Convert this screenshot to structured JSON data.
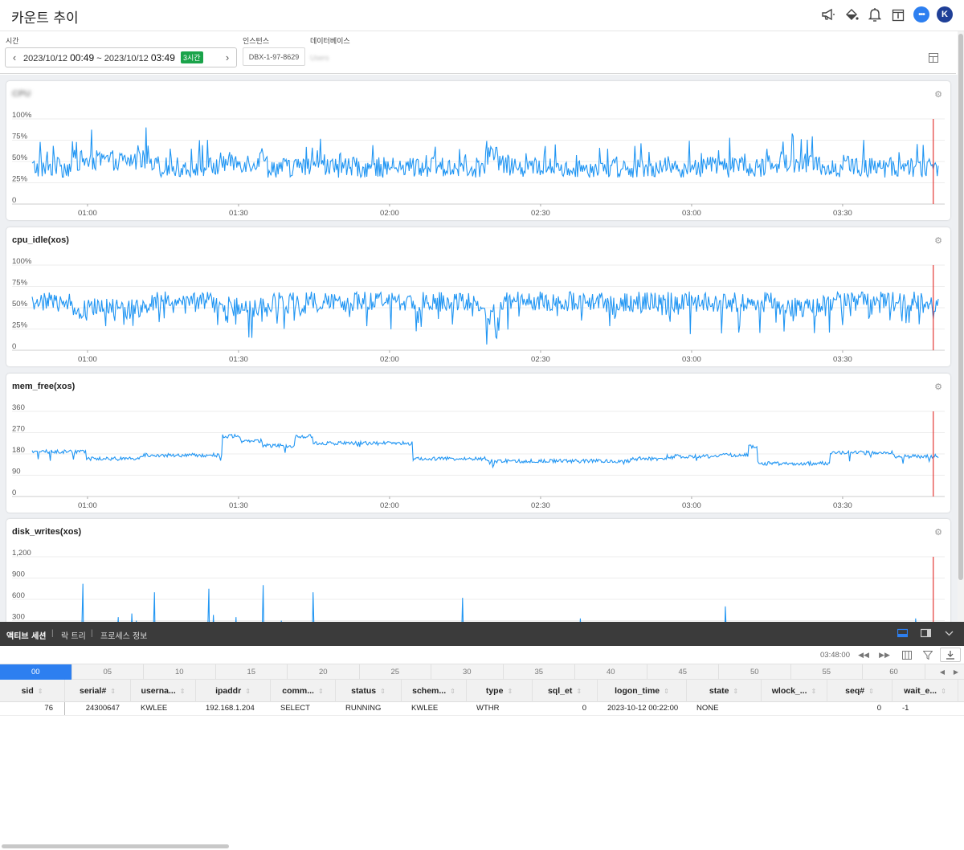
{
  "page": {
    "title": "카운트 추이"
  },
  "header_icons": [
    "megaphone-icon",
    "paint-bucket-icon",
    "bell-icon",
    "calendar-icon",
    "chat-icon"
  ],
  "user": {
    "initial": "K"
  },
  "filters": {
    "time_label": "시간",
    "time_start_date": "2023/10/12",
    "time_start_hm": "00:49",
    "time_sep": "~",
    "time_end_date": "2023/10/12",
    "time_end_hm": "03:49",
    "time_badge": "3시간",
    "instance_label": "인스턴스",
    "instance_value": "DBX-1-97-8629",
    "database_label": "데이터베이스",
    "database_value": "Users"
  },
  "colors": {
    "series": "#2196f3",
    "now_line": "#e53935",
    "accent": "#2d7ff0",
    "badge": "#1aa34a"
  },
  "chart_data": [
    {
      "type": "line",
      "title": "CPU",
      "x": {
        "start": "00:49",
        "end": "03:49",
        "ticks": [
          "01:00",
          "01:30",
          "02:00",
          "02:30",
          "03:00",
          "03:30"
        ]
      },
      "y_ticks": [
        "100%",
        "75%",
        "50%",
        "25%",
        "0"
      ],
      "ylim": [
        0,
        100
      ],
      "pattern": {
        "base": 43,
        "amp": 12,
        "spike_amp": 30,
        "steps": [
          [
            0.045,
            0.13,
            8
          ],
          [
            0.205,
            0.26,
            6
          ],
          [
            0.5,
            0.515,
            15
          ],
          [
            0.825,
            0.87,
            6
          ]
        ]
      },
      "now_marker": "03:48"
    },
    {
      "type": "line",
      "title": "cpu_idle(xos)",
      "x": {
        "start": "00:49",
        "end": "03:49",
        "ticks": [
          "01:00",
          "01:30",
          "02:00",
          "02:30",
          "03:00",
          "03:30"
        ]
      },
      "y_ticks": [
        "100%",
        "75%",
        "50%",
        "25%",
        "0"
      ],
      "ylim": [
        0,
        100
      ],
      "pattern": {
        "base": 57,
        "amp": 12,
        "spike_amp": -30,
        "steps": [
          [
            0.045,
            0.13,
            -8
          ],
          [
            0.205,
            0.26,
            -6
          ],
          [
            0.5,
            0.515,
            -15
          ],
          [
            0.825,
            0.87,
            -6
          ]
        ]
      },
      "now_marker": "03:48"
    },
    {
      "type": "line",
      "title": "mem_free(xos)",
      "x": {
        "start": "00:49",
        "end": "03:49",
        "ticks": [
          "01:00",
          "01:30",
          "02:00",
          "02:30",
          "03:00",
          "03:30"
        ]
      },
      "y_ticks": [
        "360",
        "270",
        "180",
        "90",
        "0"
      ],
      "ylim": [
        0,
        360
      ],
      "levels": [
        [
          0,
          0.06,
          190
        ],
        [
          0.06,
          0.12,
          160
        ],
        [
          0.12,
          0.17,
          175
        ],
        [
          0.17,
          0.21,
          175
        ],
        [
          0.21,
          0.23,
          255
        ],
        [
          0.23,
          0.255,
          235
        ],
        [
          0.255,
          0.29,
          215
        ],
        [
          0.29,
          0.31,
          255
        ],
        [
          0.31,
          0.34,
          225
        ],
        [
          0.34,
          0.42,
          225
        ],
        [
          0.42,
          0.5,
          160
        ],
        [
          0.5,
          0.66,
          150
        ],
        [
          0.66,
          0.7,
          160
        ],
        [
          0.7,
          0.75,
          170
        ],
        [
          0.75,
          0.79,
          175
        ],
        [
          0.79,
          0.8,
          210
        ],
        [
          0.8,
          0.88,
          140
        ],
        [
          0.88,
          0.95,
          185
        ],
        [
          0.95,
          1.0,
          170
        ]
      ],
      "now_marker": "03:48"
    },
    {
      "type": "line",
      "title": "disk_writes(xos)",
      "x": {
        "start": "00:49",
        "end": "03:49",
        "ticks": [
          "01:00",
          "01:30",
          "02:00",
          "02:30",
          "03:00",
          "03:30"
        ]
      },
      "y_ticks": [
        "1,200",
        "900",
        "600",
        "300"
      ],
      "ylim": [
        0,
        1200
      ],
      "spikes": [
        [
          0.056,
          820
        ],
        [
          0.095,
          350
        ],
        [
          0.11,
          400
        ],
        [
          0.115,
          300
        ],
        [
          0.135,
          700
        ],
        [
          0.17,
          250
        ],
        [
          0.195,
          750
        ],
        [
          0.2,
          380
        ],
        [
          0.225,
          350
        ],
        [
          0.255,
          800
        ],
        [
          0.275,
          300
        ],
        [
          0.31,
          700
        ],
        [
          0.4,
          250
        ],
        [
          0.475,
          620
        ],
        [
          0.605,
          330
        ],
        [
          0.765,
          500
        ],
        [
          0.975,
          330
        ]
      ],
      "now_marker": "03:48"
    }
  ],
  "bottom_tabs": [
    "액티브 세션",
    "락 트리",
    "프로세스 정보"
  ],
  "toolbar": {
    "time": "03:48:00"
  },
  "minutes": [
    "00",
    "05",
    "10",
    "15",
    "20",
    "25",
    "30",
    "35",
    "40",
    "45",
    "50",
    "55",
    "60"
  ],
  "table": {
    "columns": [
      "sid",
      "serial#",
      "userna...",
      "ipaddr",
      "comm...",
      "status",
      "schem...",
      "type",
      "sql_et",
      "logon_time",
      "state",
      "wlock_...",
      "seq#",
      "wait_e..."
    ],
    "rows": [
      [
        "76",
        "24300647",
        "KWLEE",
        "192.168.1.204",
        "SELECT",
        "RUNNING",
        "KWLEE",
        "WTHR",
        "0",
        "2023-10-12 00:22:00",
        "NONE",
        "",
        "0",
        "-1"
      ]
    ]
  }
}
